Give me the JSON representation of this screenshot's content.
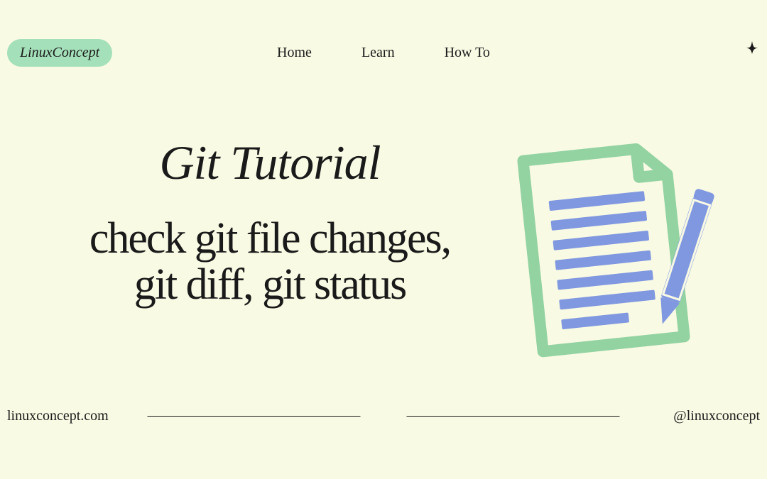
{
  "header": {
    "logo": "LinuxConcept",
    "nav": {
      "home": "Home",
      "learn": "Learn",
      "howto": "How To"
    }
  },
  "main": {
    "title": "Git Tutorial",
    "subtitle_line1": "check git file changes,",
    "subtitle_line2": "git diff, git status"
  },
  "footer": {
    "domain": "linuxconcept.com",
    "handle": "@linuxconcept"
  },
  "colors": {
    "bg": "#f9fae4",
    "accent_green": "#a4e0b9",
    "doc_green": "#93d3a2",
    "pen_blue": "#8098e0",
    "text": "#1a1a1a"
  }
}
